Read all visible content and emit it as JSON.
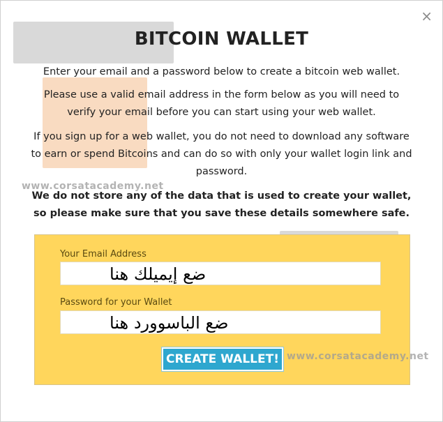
{
  "modal": {
    "close_glyph": "×",
    "title": "BITCOIN WALLET",
    "intro": "Enter your email and a password below to create a bitcoin web wallet.",
    "verify_note": "Please use a valid email address in the form below as you will need to verify your email before you can start using your web wallet.",
    "no_download_note": "If you sign up for a web wallet, you do not need to download any software to earn or spend Bitcoins and can do so with only your wallet login link and password.",
    "storage_warning": "We do not store any of the data that is used to create your wallet, so please make sure that you save these details somewhere safe."
  },
  "form": {
    "email_label": "Your Email Address",
    "email_value": "ضع إيميلك هنا",
    "password_label": "Password for your Wallet",
    "password_value": "ضع الباسوورد هنا",
    "submit_label": "CREATE WALLET!"
  },
  "watermark": {
    "url_1": "www.corsatacademy.net",
    "url_2": "www.corsatacademy.net"
  },
  "colors": {
    "panel": "#ffd65c",
    "button": "#2ea7cf"
  }
}
